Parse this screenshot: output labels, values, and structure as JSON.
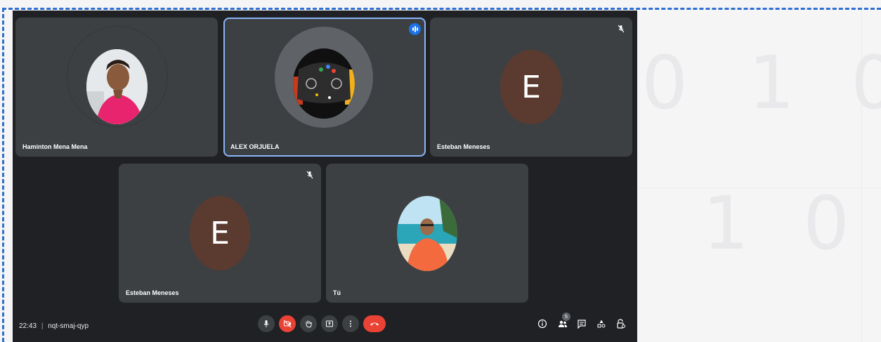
{
  "background_digits": [
    "0",
    "1",
    "0",
    "1",
    "0"
  ],
  "participants": [
    {
      "name": "Haminton Mena Mena",
      "kind": "photo",
      "muted": false,
      "speaking": false
    },
    {
      "name": "ALEX ORJUELA",
      "kind": "photo",
      "muted": false,
      "speaking": true
    },
    {
      "name": "Esteban Meneses",
      "kind": "initial",
      "initial": "E",
      "muted": true,
      "speaking": false
    },
    {
      "name": "Esteban Meneses",
      "kind": "initial",
      "initial": "E",
      "muted": true,
      "speaking": false
    },
    {
      "name": "Tú",
      "kind": "photo",
      "muted": false,
      "speaking": false
    }
  ],
  "footer": {
    "time": "22:43",
    "separator": "|",
    "meeting_code": "nqt-smaj-qyp",
    "people_count": "5"
  },
  "controls": [
    "microphone-icon",
    "camera-off-icon",
    "raise-hand-icon",
    "present-screen-icon",
    "more-options-icon",
    "leave-call-icon"
  ],
  "right_controls": [
    "info-icon",
    "people-icon",
    "chat-icon",
    "activities-icon",
    "host-controls-icon"
  ],
  "colors": {
    "meet_bg": "#202124",
    "tile_bg": "#3c4043",
    "accent": "#8ab4f8",
    "danger": "#ea4335",
    "initial_avatar": "#5b3b30"
  }
}
